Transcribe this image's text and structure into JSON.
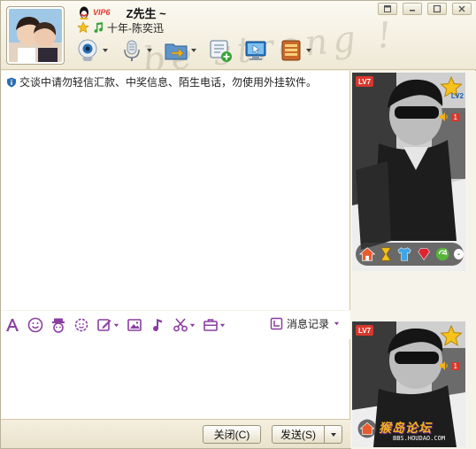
{
  "window": {
    "buttons": [
      "minimize",
      "restore",
      "maximize",
      "close"
    ]
  },
  "header": {
    "vip_label": "VIP6",
    "nickname": "Z先生 ~",
    "signature": "十年-陈奕迅",
    "watermark": "be strong !",
    "toolbar_icons": [
      "webcam-icon",
      "microphone-icon",
      "file-transfer-icon",
      "add-contact-icon",
      "remote-assist-icon",
      "app-menu-icon"
    ]
  },
  "message": {
    "notice": "交谈中请勿轻信汇款、中奖信息、陌生电话，勿使用外挂软件。"
  },
  "input_toolbar": {
    "icons": [
      "font-icon",
      "emoji-icon",
      "magic-face-icon",
      "shake-icon",
      "scribble-icon",
      "image-icon",
      "music-icon",
      "screenshot-icon",
      "briefcase-icon"
    ],
    "history_label": "消息记录"
  },
  "bottom": {
    "close_label": "关闭(C)",
    "send_label": "发送(S)"
  },
  "right_panel": {
    "level_badge": "LV7",
    "level2": "LV2",
    "vol_count": "1",
    "forum_title": "猴岛论坛",
    "forum_url": "BBS.HOUDAO.COM"
  },
  "colors": {
    "accent": "#8a3fa0",
    "badge_red": "#d8382c",
    "frame": "#f6f2e6"
  }
}
